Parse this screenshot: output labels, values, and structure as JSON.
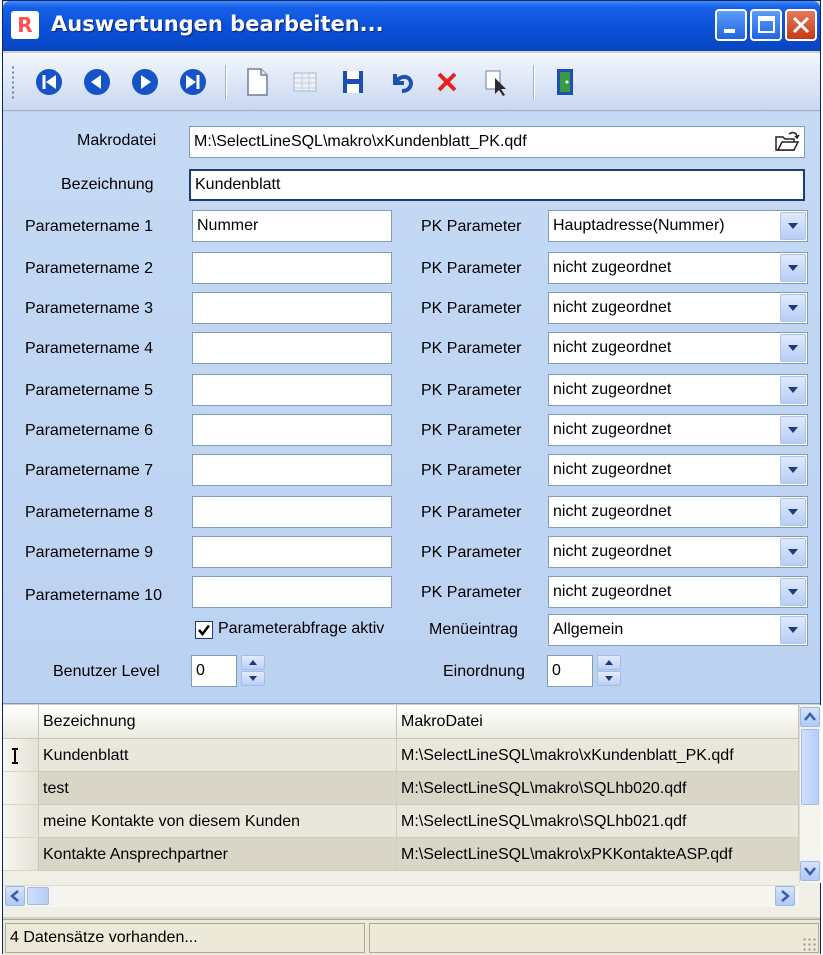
{
  "window": {
    "title": "Auswertungen bearbeiten...",
    "app_icon_letter": "R"
  },
  "toolbar": {
    "buttons": [
      {
        "name": "first-record",
        "icon": "first-record-icon"
      },
      {
        "name": "prev-record",
        "icon": "prev-record-icon"
      },
      {
        "name": "next-record",
        "icon": "next-record-icon"
      },
      {
        "name": "last-record",
        "icon": "last-record-icon"
      },
      {
        "name": "new-record",
        "icon": "new-document-icon"
      },
      {
        "name": "table-view",
        "icon": "table-icon"
      },
      {
        "name": "save",
        "icon": "save-icon"
      },
      {
        "name": "undo",
        "icon": "undo-icon"
      },
      {
        "name": "delete",
        "icon": "delete-icon"
      },
      {
        "name": "search",
        "icon": "search-cursor-icon"
      },
      {
        "name": "exit",
        "icon": "exit-door-icon"
      }
    ]
  },
  "form": {
    "makrodatei_label": "Makrodatei",
    "makrodatei_value": "M:\\SelectLineSQL\\makro\\xKundenblatt_PK.qdf",
    "bezeichnung_label": "Bezeichnung",
    "bezeichnung_value": "Kundenblatt",
    "parameters": [
      {
        "label": "Parametername 1",
        "value": "Nummer",
        "pk_label": "PK Parameter",
        "pk_value": "Hauptadresse(Nummer)"
      },
      {
        "label": "Parametername 2",
        "value": "",
        "pk_label": "PK Parameter",
        "pk_value": "nicht zugeordnet"
      },
      {
        "label": "Parametername 3",
        "value": "",
        "pk_label": "PK Parameter",
        "pk_value": "nicht zugeordnet"
      },
      {
        "label": "Parametername 4",
        "value": "",
        "pk_label": "PK Parameter",
        "pk_value": "nicht zugeordnet"
      },
      {
        "label": "Parametername 5",
        "value": "",
        "pk_label": "PK Parameter",
        "pk_value": "nicht zugeordnet"
      },
      {
        "label": "Parametername 6",
        "value": "",
        "pk_label": "PK Parameter",
        "pk_value": "nicht zugeordnet"
      },
      {
        "label": "Parametername 7",
        "value": "",
        "pk_label": "PK Parameter",
        "pk_value": "nicht zugeordnet"
      },
      {
        "label": "Parametername 8",
        "value": "",
        "pk_label": "PK Parameter",
        "pk_value": "nicht zugeordnet"
      },
      {
        "label": "Parametername 9",
        "value": "",
        "pk_label": "PK Parameter",
        "pk_value": "nicht zugeordnet"
      },
      {
        "label": "Parametername 10",
        "value": "",
        "pk_label": "PK Parameter",
        "pk_value": "nicht zugeordnet"
      }
    ],
    "parameterabfrage_label": "Parameterabfrage aktiv",
    "parameterabfrage_checked": true,
    "menueeintrag_label": "Menüeintrag",
    "menueeintrag_value": "Allgemein",
    "benutzer_level_label": "Benutzer Level",
    "benutzer_level_value": "0",
    "einordnung_label": "Einordnung",
    "einordnung_value": "0"
  },
  "grid": {
    "columns": [
      "Bezeichnung",
      "MakroDatei"
    ],
    "rows": [
      {
        "bezeichnung": "Kundenblatt",
        "makrodatei": "M:\\SelectLineSQL\\makro\\xKundenblatt_PK.qdf",
        "current": true
      },
      {
        "bezeichnung": "test",
        "makrodatei": "M:\\SelectLineSQL\\makro\\SQLhb020.qdf",
        "current": false
      },
      {
        "bezeichnung": "meine Kontakte von diesem Kunden",
        "makrodatei": "M:\\SelectLineSQL\\makro\\SQLhb021.qdf",
        "current": false
      },
      {
        "bezeichnung": "Kontakte Ansprechpartner",
        "makrodatei": "M:\\SelectLineSQL\\makro\\xPKKontakteASP.qdf",
        "current": false
      }
    ]
  },
  "status": {
    "text": "4 Datensätze vorhanden..."
  }
}
